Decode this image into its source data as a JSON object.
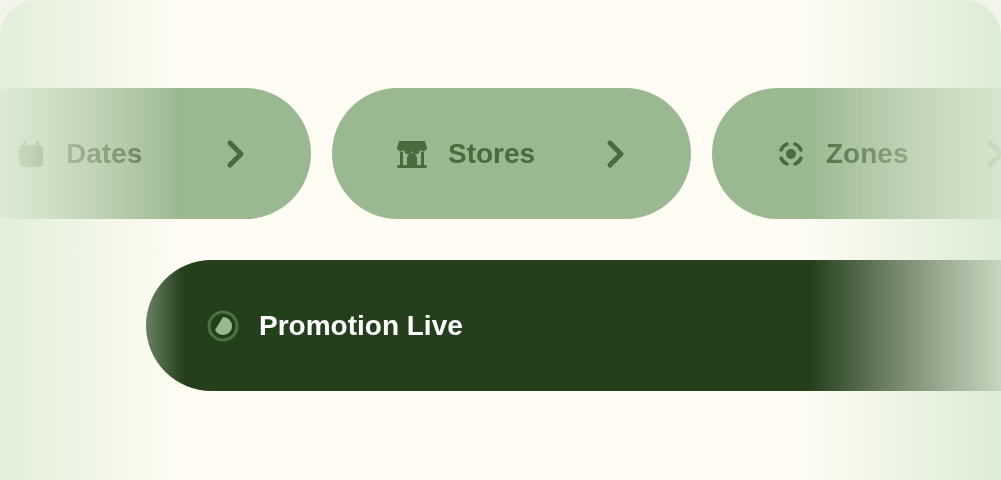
{
  "filters": [
    {
      "label": "Dates"
    },
    {
      "label": "Stores"
    },
    {
      "label": "Zones"
    }
  ],
  "status": {
    "label": "Promotion Live"
  }
}
